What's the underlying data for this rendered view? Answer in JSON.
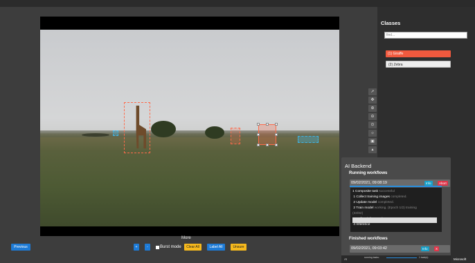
{
  "classes_panel": {
    "title": "Classes",
    "search_placeholder": "find...",
    "items": [
      {
        "label": "(1) Giraffe",
        "color": "#f0593e"
      },
      {
        "label": "(2) Zebra",
        "color": "#eeeeee"
      }
    ]
  },
  "viewer": {
    "more_label": "More"
  },
  "bottom_bar": {
    "previous_label": "Previous",
    "plus_label": "+",
    "minus_label": "-",
    "burst_label": "Burst mode",
    "clear_all_label": "Clear All",
    "label_all_label": "Label All",
    "unsure_label": "Unsure"
  },
  "toolbar": {
    "icons": [
      "select-icon",
      "move-icon",
      "zoom-in-icon",
      "zoom-out-icon",
      "reset-zoom-icon",
      "brightness-icon",
      "fullscreen-icon",
      "expand-up-icon"
    ]
  },
  "ai_backend": {
    "title": "AI Backend",
    "running_label": "Running workflows",
    "running": {
      "date": "09/02/2021, 09:08:19",
      "info_label": "Info",
      "abort_label": "Abort",
      "progress": 1.0
    },
    "tasks": [
      {
        "num": "1",
        "name": "Composite task",
        "status": "successful"
      },
      {
        "num": "1",
        "name": "Collect training images",
        "status": "completed."
      },
      {
        "num": "2",
        "name": "Update model",
        "status": "completed."
      },
      {
        "num": "2",
        "name": "Train model",
        "status": "working. (Epoch 1/2) training"
      },
      {
        "num": "",
        "name": "(33/82)",
        "status": ""
      },
      {
        "num": "3",
        "name": "Collect inference images",
        "status": ""
      },
      {
        "num": "4",
        "name": "Inference",
        "status": ""
      }
    ],
    "finished_label": "Finished workflows",
    "finished": {
      "date": "09/02/2021, 09:03:42",
      "info_label": "Info",
      "close_label": "X"
    }
  },
  "statusbar": {
    "ai_label": "AI",
    "running_tasks": "running tasks:",
    "tasks_count": "1 task(s)",
    "ms_label": "Microsoft"
  },
  "colors": {
    "accent_blue": "#1e7bd6",
    "accent_yellow": "#f6b91d",
    "giraffe_box": "#ff6a4a",
    "zebra_box": "#3fb5e6"
  }
}
